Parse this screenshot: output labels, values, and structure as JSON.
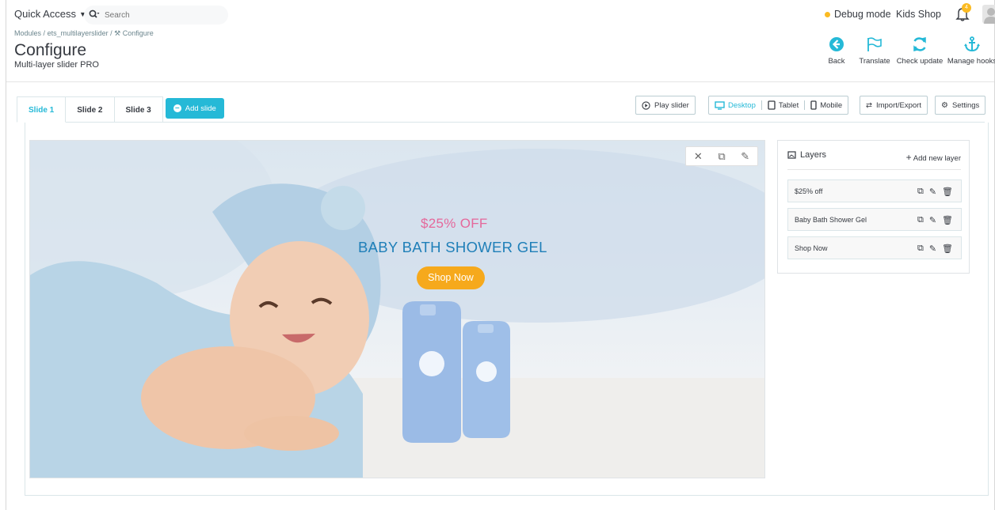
{
  "header": {
    "quick_access": "Quick Access",
    "search_placeholder": "Search",
    "debug_mode": "Debug mode",
    "shop_name": "Kids Shop",
    "notification_count": "4"
  },
  "breadcrumb": {
    "items": [
      "Modules",
      "ets_multilayerslider",
      "Configure"
    ],
    "separator": "/"
  },
  "page": {
    "title": "Configure",
    "subtitle": "Multi-layer slider PRO"
  },
  "toolbar": {
    "back": "Back",
    "translate": "Translate",
    "check_update": "Check update",
    "manage_hooks": "Manage hooks"
  },
  "tabs": {
    "items": [
      "Slide 1",
      "Slide 2",
      "Slide 3"
    ],
    "active": "Slide 1",
    "add_slide": "Add slide"
  },
  "controls": {
    "play_slider": "Play slider",
    "desktop": "Desktop",
    "tablet": "Tablet",
    "mobile": "Mobile",
    "active_device": "Desktop",
    "import_export": "Import/Export",
    "settings": "Settings"
  },
  "slide": {
    "layer_discount": "$25% OFF",
    "layer_title": "BABY BATH SHOWER GEL",
    "layer_button": "Shop Now"
  },
  "layers_panel": {
    "title": "Layers",
    "add_new": "Add new layer",
    "items": [
      "$25% off",
      "Baby Bath Shower Gel",
      "Shop Now"
    ]
  },
  "colors": {
    "accent": "#25b9d7",
    "warning": "#fbbb22",
    "discount": "#e5689b",
    "headline": "#1f7fb8",
    "cta": "#f6a91c"
  }
}
